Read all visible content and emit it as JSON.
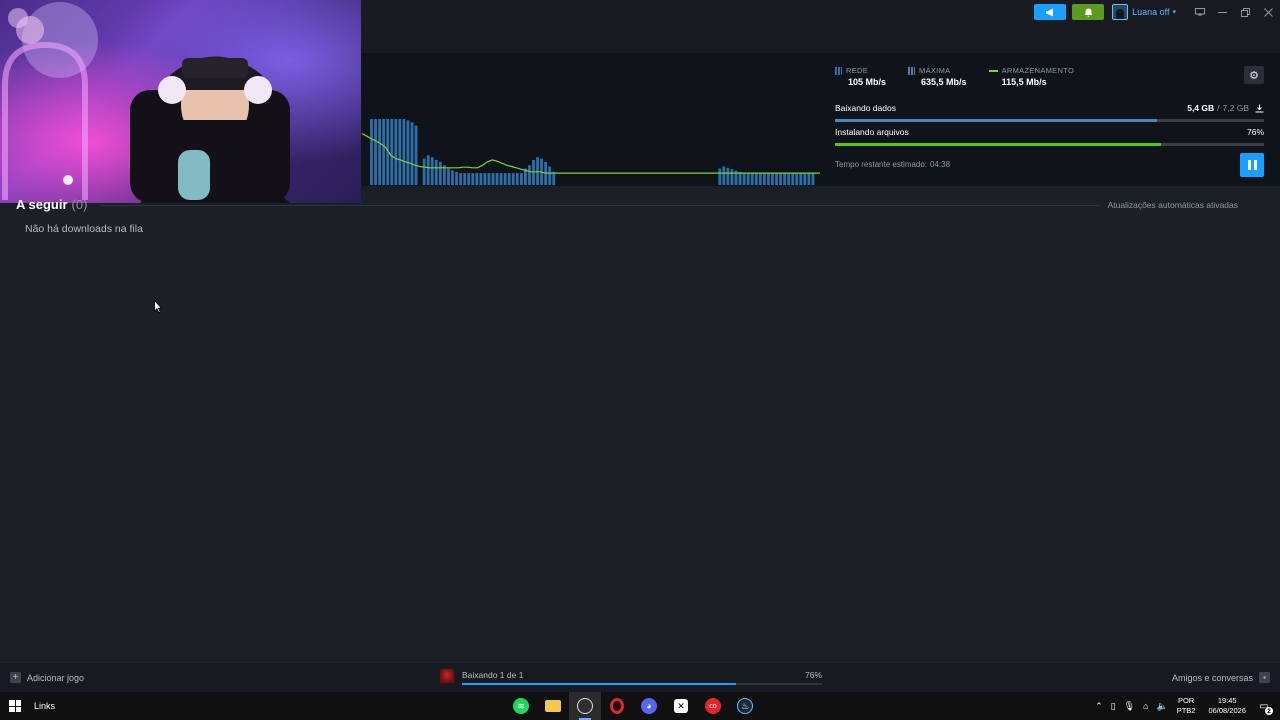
{
  "topbar": {
    "announce_icon": "megaphone-icon",
    "notify_icon": "bell-icon",
    "user_name": "Luana off",
    "window_controls": [
      "monitor-icon",
      "minimize-icon",
      "restore-icon",
      "close-icon"
    ]
  },
  "stats": {
    "network_label": "REDE",
    "network_value": "105 Mb/s",
    "peak_label": "MÁXIMA",
    "peak_value": "635,5 Mb/s",
    "storage_label": "ARMAZENAMENTO",
    "storage_value": "115,5 Mb/s"
  },
  "download": {
    "downloading_label": "Baixando dados",
    "downloaded": "5,4 GB",
    "separator": "/",
    "total": "7,2 GB",
    "download_progress": 0.75,
    "installing_label": "Instalando arquivos",
    "install_percent": "76%",
    "install_progress": 0.76,
    "eta_label": "Tempo restante estimado:",
    "eta_value": "04:38"
  },
  "queue": {
    "title": "A seguir",
    "count": "(0)",
    "auto_updates": "Atualizações automáticas ativadas",
    "empty": "Não há downloads na fila"
  },
  "footer": {
    "add_game": "Adicionar jogo",
    "status": "Baixando 1 de 1",
    "percent": "76%",
    "progress": 0.76,
    "friends": "Amigos e conversas"
  },
  "taskbar": {
    "links": "Links",
    "apps": [
      "spotify-icon",
      "file-explorer-icon",
      "obs-icon",
      "opera-gx-icon",
      "discord-icon",
      "capcut-icon",
      "cocos-icon",
      "steam-icon"
    ],
    "lang_line1": "POR",
    "lang_line2": "PTB2",
    "time": "19:45",
    "date": "06/08/2026",
    "notif_count": "2"
  },
  "colors": {
    "accent_blue": "#1a9fff",
    "install_green": "#5ac800",
    "graph_bars": "#2d6ea8",
    "graph_line": "#7bd23a"
  },
  "graph": {
    "network_bars": [
      0,
      0,
      100,
      100,
      100,
      100,
      100,
      100,
      100,
      100,
      100,
      98,
      95,
      90,
      0,
      40,
      45,
      42,
      38,
      35,
      30,
      25,
      22,
      20,
      18,
      18,
      18,
      18,
      18,
      18,
      18,
      18,
      18,
      18,
      18,
      18,
      18,
      18,
      18,
      18,
      25,
      30,
      38,
      42,
      40,
      35,
      28,
      20,
      0,
      0,
      0,
      0,
      0,
      0,
      0,
      0,
      0,
      0,
      0,
      0,
      0,
      0,
      0,
      0,
      0,
      0,
      0,
      0,
      0,
      0,
      0,
      0,
      0,
      0,
      0,
      0,
      0,
      0,
      0,
      0,
      0,
      0,
      0,
      0,
      0,
      0,
      0,
      0,
      25,
      28,
      26,
      24,
      22,
      20,
      18,
      18,
      18,
      18,
      18,
      18,
      18,
      18,
      18,
      18,
      18,
      18,
      18,
      18,
      18,
      18,
      18,
      18
    ],
    "disk_line": [
      78,
      74,
      70,
      66,
      62,
      56,
      45,
      40,
      38,
      35,
      33,
      30,
      28,
      27,
      26,
      26,
      26,
      26,
      26,
      26,
      26,
      27,
      27,
      26,
      26,
      30,
      35,
      38,
      36,
      33,
      30,
      28,
      26,
      24,
      22,
      20,
      20,
      20,
      18,
      18,
      18,
      18,
      18,
      18,
      18,
      18,
      18,
      18,
      18,
      18,
      18,
      18,
      18,
      18,
      18,
      18,
      18,
      18,
      18,
      18,
      18,
      18,
      18,
      18,
      18,
      18,
      18,
      18,
      18,
      18,
      18,
      18,
      18,
      18,
      18,
      18,
      18,
      18,
      18,
      18,
      18,
      18,
      18,
      18,
      18,
      18,
      18,
      18,
      18,
      18,
      18,
      18,
      18,
      18,
      18,
      18
    ]
  }
}
